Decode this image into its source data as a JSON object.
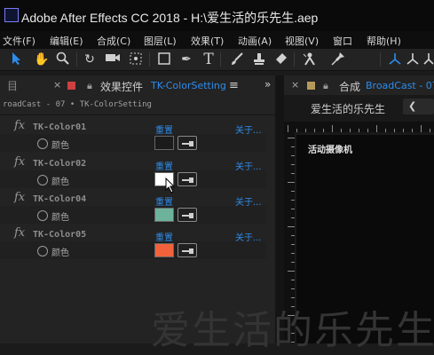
{
  "titlebar": {
    "title": "Adobe After Effects CC 2018 - H:\\爱生活的乐先生.aep"
  },
  "menu": [
    {
      "label": "文件(F)"
    },
    {
      "label": "编辑(E)"
    },
    {
      "label": "合成(C)"
    },
    {
      "label": "图层(L)"
    },
    {
      "label": "效果(T)"
    },
    {
      "label": "动画(A)"
    },
    {
      "label": "视图(V)"
    },
    {
      "label": "窗口"
    },
    {
      "label": "帮助(H)"
    }
  ],
  "toolbar": {
    "tools": [
      "select-tool",
      "hand-tool",
      "zoom-tool",
      "rotate-tool",
      "camera-tool",
      "pan-behind-tool",
      "rectangle-tool",
      "pen-tool",
      "type-tool",
      "brush-tool",
      "clone-stamp-tool",
      "eraser-tool",
      "roto-brush-tool",
      "puppet-pin-tool",
      "axis-tool",
      "axis-tool-2",
      "axis-tool-3"
    ]
  },
  "effect_controls": {
    "panel_icon": "≡",
    "tab_label": "效果控件",
    "layer_name": "TK-ColorSetting",
    "breadcrumb": "roadCast - 07 • TK-ColorSetting",
    "reset_label": "重置",
    "about_label": "关于...",
    "effects": [
      {
        "name": "TK-Color01",
        "property": "颜色",
        "color": "#1b1b1b"
      },
      {
        "name": "TK-Color02",
        "property": "颜色",
        "color": "#ffffff"
      },
      {
        "name": "TK-Color04",
        "property": "颜色",
        "color": "#6db39b"
      },
      {
        "name": "TK-Color05",
        "property": "颜色",
        "color": "#f1623c"
      }
    ]
  },
  "composition": {
    "tab_prefix": "合成",
    "comp_name": "BroadCast - 07",
    "header_text": "爱生活的乐先生",
    "camera_label": "活动摄像机"
  },
  "watermark": "爱生活的乐先生",
  "colors": {
    "accent": "#2d8ceb",
    "close_icon": "#d04040"
  }
}
